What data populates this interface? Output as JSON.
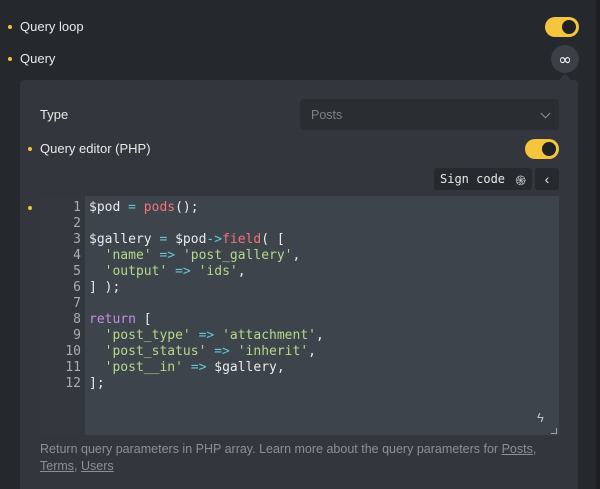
{
  "query_loop": {
    "label": "Query loop",
    "enabled": true
  },
  "query": {
    "label": "Query",
    "button_icon": "infinity-icon",
    "button_glyph": "∞"
  },
  "panel": {
    "type": {
      "label": "Type",
      "value": "Posts"
    },
    "query_editor": {
      "label": "Query editor (PHP)",
      "enabled": true
    },
    "sign_code": {
      "label": "Sign code",
      "icon": "fingerprint-icon",
      "glyph": "֍"
    },
    "collapse_glyph": "‹",
    "code": {
      "line_numbers": [
        "1",
        "2",
        "3",
        "4",
        "5",
        "6",
        "7",
        "8",
        "9",
        "10",
        "11",
        "12"
      ],
      "lines": [
        [
          {
            "t": "var",
            "v": "$pod"
          },
          {
            "t": "pun",
            "v": " "
          },
          {
            "t": "op",
            "v": "="
          },
          {
            "t": "pun",
            "v": " "
          },
          {
            "t": "fn",
            "v": "pods"
          },
          {
            "t": "pun",
            "v": "();"
          }
        ],
        [],
        [
          {
            "t": "var",
            "v": "$gallery"
          },
          {
            "t": "pun",
            "v": " "
          },
          {
            "t": "op",
            "v": "="
          },
          {
            "t": "pun",
            "v": " "
          },
          {
            "t": "var",
            "v": "$pod"
          },
          {
            "t": "op",
            "v": "->"
          },
          {
            "t": "fn",
            "v": "field"
          },
          {
            "t": "pun",
            "v": "( ["
          }
        ],
        [
          {
            "t": "pun",
            "v": "  "
          },
          {
            "t": "str",
            "v": "'name'"
          },
          {
            "t": "pun",
            "v": " "
          },
          {
            "t": "op",
            "v": "=>"
          },
          {
            "t": "pun",
            "v": " "
          },
          {
            "t": "str",
            "v": "'post_gallery'"
          },
          {
            "t": "pun",
            "v": ","
          }
        ],
        [
          {
            "t": "pun",
            "v": "  "
          },
          {
            "t": "str",
            "v": "'output'"
          },
          {
            "t": "pun",
            "v": " "
          },
          {
            "t": "op",
            "v": "=>"
          },
          {
            "t": "pun",
            "v": " "
          },
          {
            "t": "str",
            "v": "'ids'"
          },
          {
            "t": "pun",
            "v": ","
          }
        ],
        [
          {
            "t": "pun",
            "v": "] );"
          }
        ],
        [],
        [
          {
            "t": "kw",
            "v": "return"
          },
          {
            "t": "pun",
            "v": " ["
          }
        ],
        [
          {
            "t": "pun",
            "v": "  "
          },
          {
            "t": "str",
            "v": "'post_type'"
          },
          {
            "t": "pun",
            "v": " "
          },
          {
            "t": "op",
            "v": "=>"
          },
          {
            "t": "pun",
            "v": " "
          },
          {
            "t": "str",
            "v": "'attachment'"
          },
          {
            "t": "pun",
            "v": ","
          }
        ],
        [
          {
            "t": "pun",
            "v": "  "
          },
          {
            "t": "str",
            "v": "'post_status'"
          },
          {
            "t": "pun",
            "v": " "
          },
          {
            "t": "op",
            "v": "=>"
          },
          {
            "t": "pun",
            "v": " "
          },
          {
            "t": "str",
            "v": "'inherit'"
          },
          {
            "t": "pun",
            "v": ","
          }
        ],
        [
          {
            "t": "pun",
            "v": "  "
          },
          {
            "t": "str",
            "v": "'post__in'"
          },
          {
            "t": "pun",
            "v": " "
          },
          {
            "t": "op",
            "v": "=>"
          },
          {
            "t": "pun",
            "v": " "
          },
          {
            "t": "var",
            "v": "$gallery"
          },
          {
            "t": "pun",
            "v": ","
          }
        ],
        [
          {
            "t": "pun",
            "v": "];"
          }
        ]
      ]
    },
    "help": {
      "text": "Return query parameters in PHP array. Learn more about the query parameters for ",
      "link_posts": "Posts",
      "comma": ", ",
      "link_terms": "Terms",
      "link_users": "Users"
    },
    "bolt_glyph": "ϟ"
  },
  "colors": {
    "accent": "#f4c53d",
    "background": "#25282c",
    "panel": "#33373d",
    "editor": "#3e444b"
  }
}
